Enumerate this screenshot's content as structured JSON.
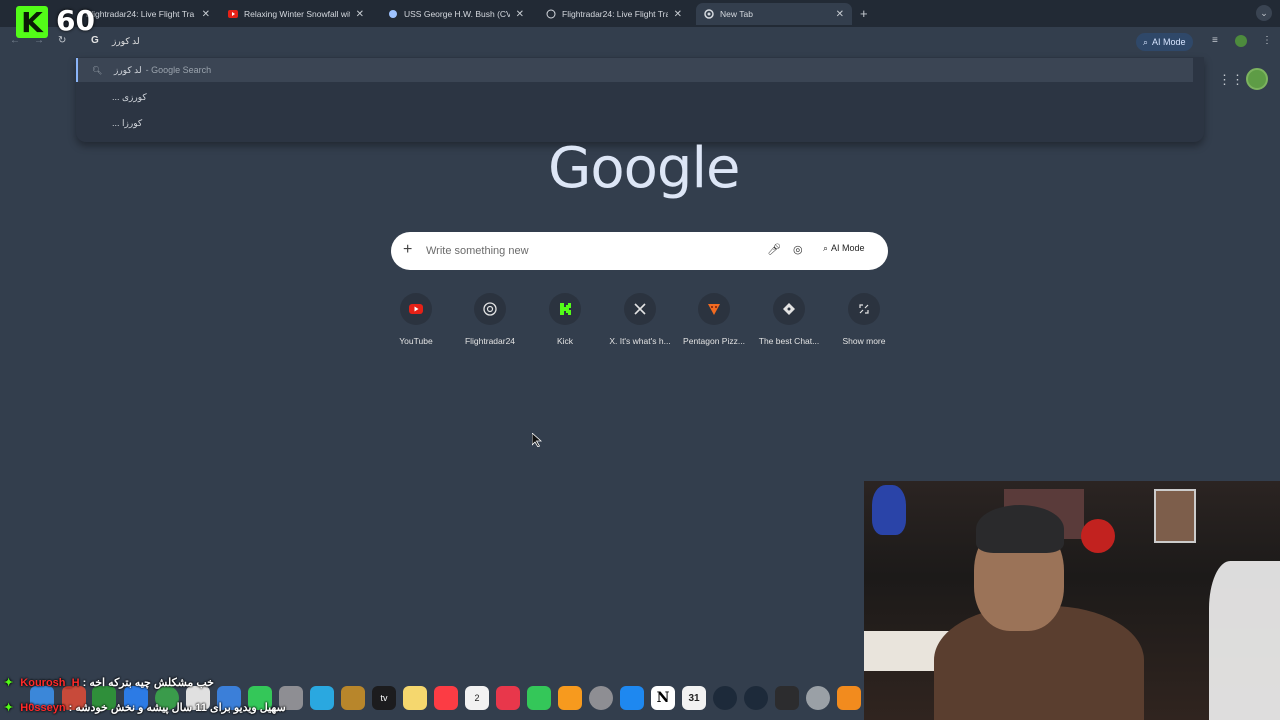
{
  "overlay": {
    "kick_logo": "K",
    "viewer_count": "60"
  },
  "tabs": [
    {
      "title": "Flightradar24: Live Flight Tra",
      "favicon": "radar-icon"
    },
    {
      "title": "Relaxing Winter Snowfall with",
      "favicon": "youtube-icon"
    },
    {
      "title": "USS George H.W. Bush (CVN",
      "favicon": "ship-icon"
    },
    {
      "title": "Flightradar24: Live Flight Tra",
      "favicon": "radar-icon"
    },
    {
      "title": "New Tab",
      "favicon": "chrome-icon"
    }
  ],
  "omnibox": {
    "query": "لد کورز",
    "ai_mode_label": "AI Mode"
  },
  "dropdown": {
    "suggestions": [
      {
        "text": "لد کورز",
        "hint": "- Google Search"
      },
      {
        "text": "... کورزی",
        "hint": ""
      },
      {
        "text": "... کورزا",
        "hint": ""
      }
    ]
  },
  "page": {
    "logo": "Google",
    "search_placeholder": "Write something new",
    "ai_mode_label": "AI Mode"
  },
  "shortcuts": [
    {
      "label": "YouTube",
      "icon": "youtube-icon",
      "color": "#e62117"
    },
    {
      "label": "Flightradar24",
      "icon": "radar-icon",
      "color": "#e3e3e3"
    },
    {
      "label": "Kick",
      "icon": "kick-icon",
      "color": "#53fc18"
    },
    {
      "label": "X. It's what's h...",
      "icon": "x-icon",
      "color": "#e3e3e3"
    },
    {
      "label": "Pentagon Pizz...",
      "icon": "pizza-icon",
      "color": "#f26b21"
    },
    {
      "label": "The best Chat...",
      "icon": "chat-icon",
      "color": "#e3e3e3"
    },
    {
      "label": "Show more",
      "icon": "expand-icon",
      "color": "#e3e3e3"
    }
  ],
  "chat": [
    {
      "user": "Kourosh_H",
      "message": "خب مشکلش چیه بترکه اخه"
    },
    {
      "user": "H0sseyn",
      "message": "سهیل ویدیو برای 11 سال پیشه و نخش خودشه"
    }
  ],
  "dock": {
    "apps_tv_label": "tv",
    "calendar_day": "31",
    "calendar_small": "2"
  }
}
